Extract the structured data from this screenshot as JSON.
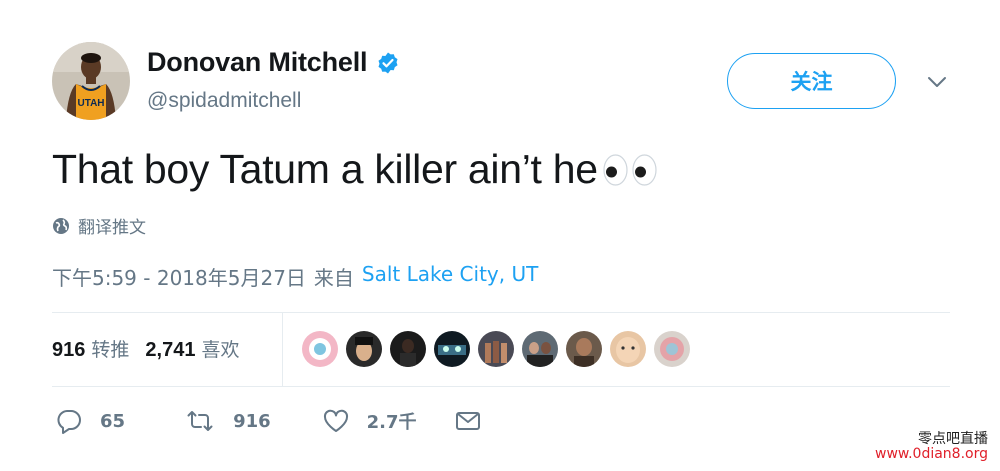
{
  "user": {
    "display_name": "Donovan Mitchell",
    "handle": "@spidadmitchell",
    "verified": true,
    "avatar_jersey_text": "UTAH"
  },
  "follow_button": {
    "label": "关注"
  },
  "tweet": {
    "text": "That boy Tatum a killer ain’t he",
    "emoji": "eyes-emoji"
  },
  "translate": {
    "label": "翻译推文"
  },
  "meta": {
    "timestamp": "下午5:59 - 2018年5月27日",
    "from_label": "来自",
    "location": "Salt Lake City, UT"
  },
  "stats": {
    "retweets_count": "916",
    "retweets_label": "转推",
    "likes_count": "2,741",
    "likes_label": "喜欢"
  },
  "likers_count_shown": 9,
  "actions": {
    "reply_count": "65",
    "retweet_count": "916",
    "like_count": "2.7千"
  },
  "watermark": {
    "line1": "零点吧直播",
    "line2": "www.0dian8.org"
  },
  "colors": {
    "accent": "#1da1f2",
    "text_primary": "#14171a",
    "text_secondary": "#657786",
    "divider": "#e6ecf0",
    "watermark_red": "#e0202a"
  }
}
